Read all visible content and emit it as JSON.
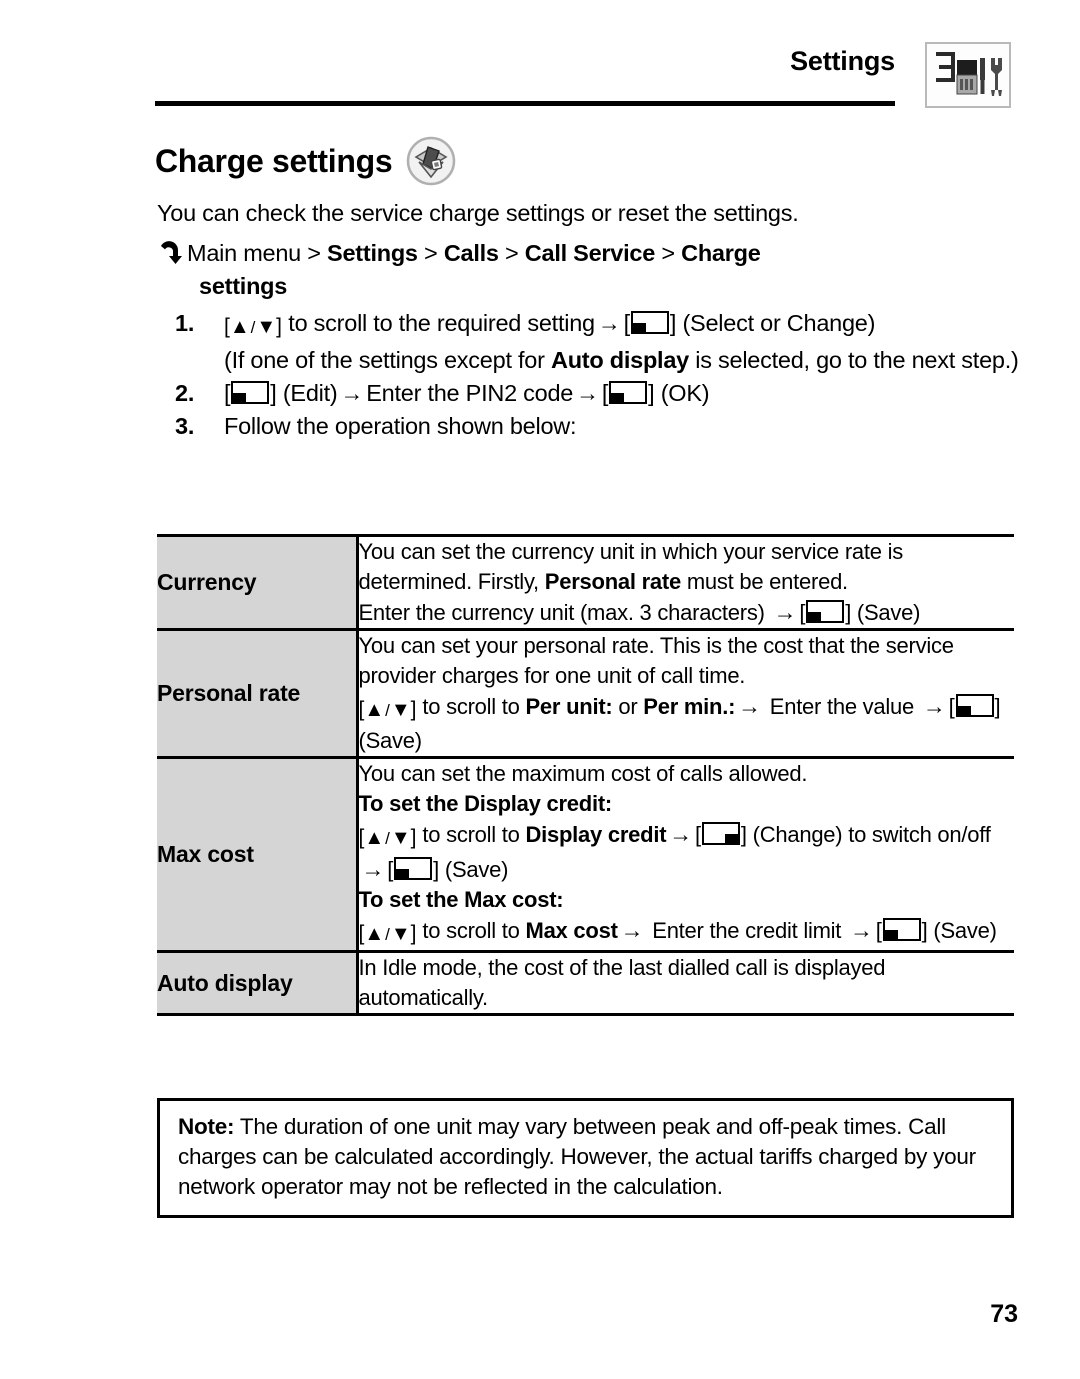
{
  "header": {
    "chapter_title": "Settings",
    "chapter_icon": "phone-tools-icon"
  },
  "section": {
    "heading": "Charge settings",
    "heading_icon": "charge-settings-icon",
    "intro": "You can check the service charge settings or reset the settings."
  },
  "path": {
    "icon": "enter-arrow-icon",
    "prefix": "Main menu",
    "sep": " > ",
    "crumbs": [
      "Settings",
      "Calls",
      "Call Service",
      "Charge"
    ],
    "wrap": "settings"
  },
  "steps": {
    "step1": {
      "num": "1.",
      "a": "to scroll to the required setting",
      "b": "(Select or Change)"
    },
    "step1_note": "(If one of the settings except for ",
    "step1_note_bold": "Auto display",
    "step1_note_tail": " is selected, go to the next step.)",
    "step2": {
      "num": "2.",
      "a": "(Edit)",
      "b": "Enter the PIN2 code",
      "c": "(OK)"
    },
    "step3": {
      "num": "3.",
      "text": "Follow the operation shown below:"
    }
  },
  "table": {
    "rows": [
      {
        "label": "Currency",
        "lines": [
          {
            "parts": [
              {
                "t": "text",
                "v": "You can set the currency unit in which your service rate is determined. Firstly, "
              },
              {
                "t": "bold",
                "v": "Personal rate"
              },
              {
                "t": "text",
                "v": " must be entered."
              }
            ]
          },
          {
            "parts": [
              {
                "t": "text",
                "v": "Enter the currency unit (max. 3 characters) "
              },
              {
                "t": "arrow",
                "v": "→"
              },
              {
                "t": "key-left",
                "v": ""
              },
              {
                "t": "text",
                "v": " (Save)"
              }
            ]
          }
        ]
      },
      {
        "label": "Personal rate",
        "lines": [
          {
            "parts": [
              {
                "t": "text",
                "v": "You can set your personal rate. This is the cost that the service provider charges for one unit of call time."
              }
            ]
          },
          {
            "parts": [
              {
                "t": "updown",
                "v": ""
              },
              {
                "t": "text",
                "v": " to scroll to "
              },
              {
                "t": "bold",
                "v": "Per unit:"
              },
              {
                "t": "text",
                "v": " or "
              },
              {
                "t": "bold",
                "v": "Per min.:"
              },
              {
                "t": "arrow",
                "v": "→"
              },
              {
                "t": "text",
                "v": " Enter the value "
              },
              {
                "t": "arrow",
                "v": "→"
              },
              {
                "t": "key-left",
                "v": ""
              },
              {
                "t": "text",
                "v": " (Save)"
              }
            ]
          }
        ]
      },
      {
        "label": "Max cost",
        "lines": [
          {
            "parts": [
              {
                "t": "text",
                "v": "You can set the maximum cost of calls allowed."
              }
            ]
          },
          {
            "parts": [
              {
                "t": "bold",
                "v": "To set the Display credit:"
              }
            ]
          },
          {
            "parts": [
              {
                "t": "updown",
                "v": ""
              },
              {
                "t": "text",
                "v": " to scroll to "
              },
              {
                "t": "bold",
                "v": "Display credit"
              },
              {
                "t": "arrow",
                "v": "→"
              },
              {
                "t": "key-right",
                "v": ""
              },
              {
                "t": "text",
                "v": " (Change) to switch on/off "
              },
              {
                "t": "arrow",
                "v": "→"
              },
              {
                "t": "key-left",
                "v": ""
              },
              {
                "t": "text",
                "v": " (Save)"
              }
            ]
          },
          {
            "parts": [
              {
                "t": "bold",
                "v": "To set the Max cost:"
              }
            ]
          },
          {
            "parts": [
              {
                "t": "updown",
                "v": ""
              },
              {
                "t": "text",
                "v": " to scroll to "
              },
              {
                "t": "bold",
                "v": "Max cost"
              },
              {
                "t": "arrow",
                "v": "→"
              },
              {
                "t": "text",
                "v": " Enter the credit limit "
              },
              {
                "t": "arrow",
                "v": "→"
              },
              {
                "t": "key-left",
                "v": ""
              },
              {
                "t": "text",
                "v": " (Save)"
              }
            ]
          }
        ]
      },
      {
        "label": "Auto display",
        "lines": [
          {
            "parts": [
              {
                "t": "text",
                "v": "In Idle mode, the cost of the last dialled call is displayed automatically."
              }
            ]
          }
        ]
      }
    ]
  },
  "note": {
    "label": "Note:",
    "text": " The duration of one unit may vary between peak and off-peak times. Call charges can be calculated accordingly. However, the actual tariffs charged by your network operator may not be reflected in the calculation."
  },
  "footer": {
    "page_number": "73"
  }
}
